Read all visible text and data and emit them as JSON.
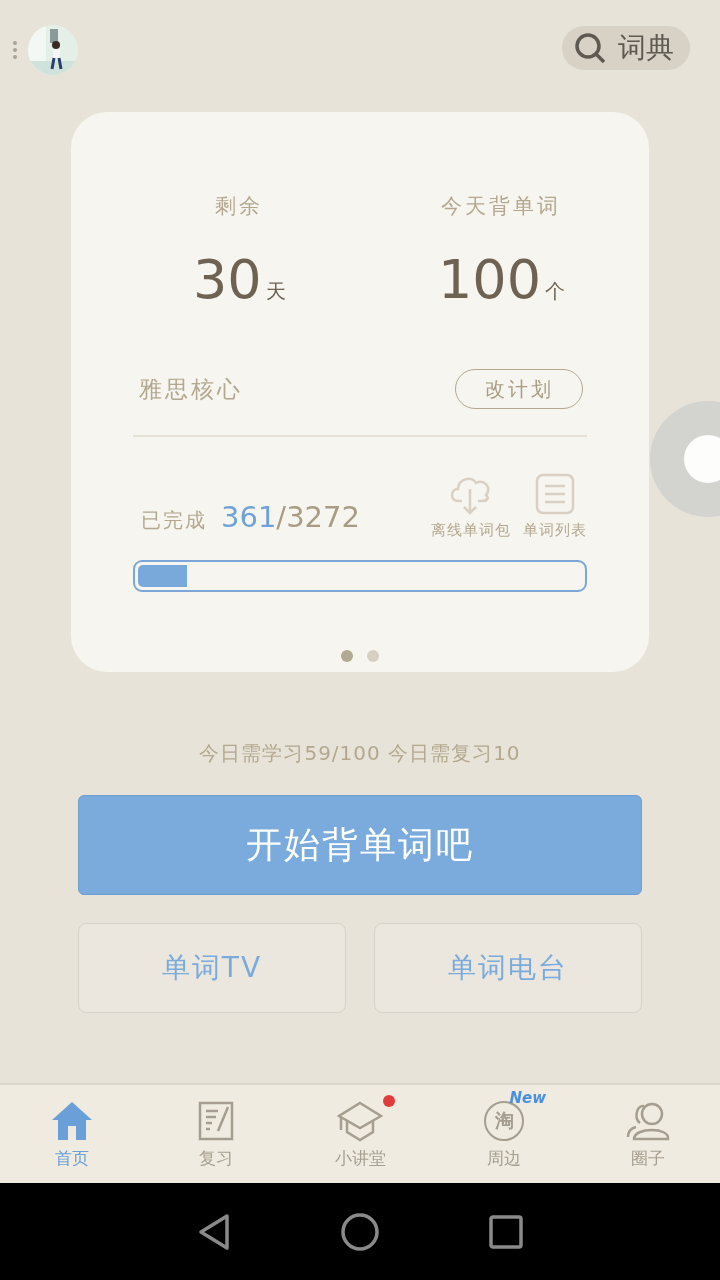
{
  "header": {
    "search_button": {
      "label": "词典"
    }
  },
  "plan_card": {
    "stats": [
      {
        "label": "剩余",
        "value": "30",
        "unit": "天"
      },
      {
        "label": "今天背单词",
        "value": "100",
        "unit": "个"
      }
    ],
    "book": "雅思核心",
    "change_button": "改计划",
    "progress": {
      "label": "已完成",
      "done": "361",
      "total": "/3272",
      "level": 0.11
    },
    "actions": [
      {
        "label": "离线单词包",
        "kind": "download"
      },
      {
        "label": "单词列表",
        "kind": "list"
      }
    ],
    "pages": [
      {
        "selected": true
      },
      {
        "selected": false
      }
    ]
  },
  "daily_summary": "今日需学习59/100 今日需复习10",
  "start_button": "开始背单词吧",
  "secondary_buttons": [
    "单词TV",
    "单词电台"
  ],
  "tabs": [
    {
      "label": "首页",
      "kind": "home",
      "selected": true,
      "dot": false
    },
    {
      "label": "复习",
      "kind": "note",
      "selected": false,
      "dot": false
    },
    {
      "label": "小讲堂",
      "kind": "cap",
      "selected": false,
      "dot": true
    },
    {
      "label": "周边",
      "kind": "coin",
      "icon_text": "淘",
      "badge": "New",
      "selected": false,
      "dot": false
    },
    {
      "label": "圈子",
      "kind": "people",
      "selected": false,
      "dot": false
    }
  ]
}
